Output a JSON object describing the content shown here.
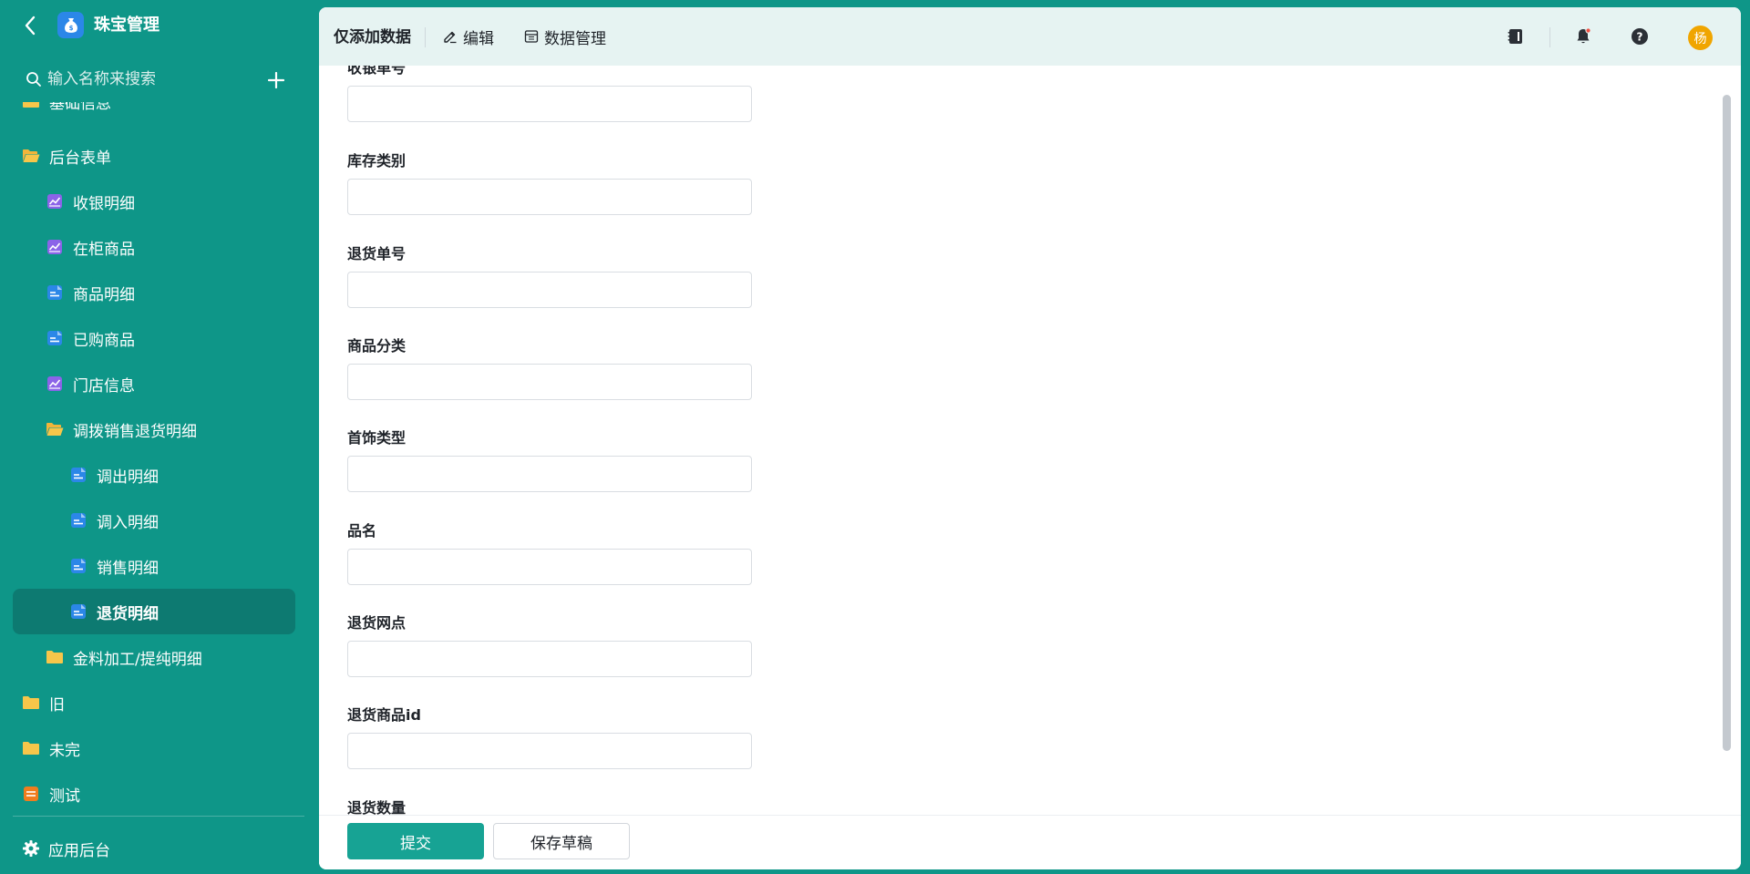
{
  "app": {
    "name": "珠宝管理",
    "search_placeholder": "输入名称来搜索"
  },
  "sidebar": {
    "items": [
      {
        "label": "基础信息",
        "icon": "folder-icon"
      },
      {
        "label": "后台表单",
        "icon": "folder-open-icon"
      },
      {
        "label": "收银明细",
        "icon": "report-chart-icon"
      },
      {
        "label": "在柜商品",
        "icon": "report-chart-icon"
      },
      {
        "label": "商品明细",
        "icon": "form-doc-icon"
      },
      {
        "label": "已购商品",
        "icon": "form-doc-icon"
      },
      {
        "label": "门店信息",
        "icon": "report-chart-icon"
      },
      {
        "label": "调拨销售退货明细",
        "icon": "folder-open-icon"
      },
      {
        "label": "调出明细",
        "icon": "form-doc-icon"
      },
      {
        "label": "调入明细",
        "icon": "form-doc-icon"
      },
      {
        "label": "销售明细",
        "icon": "form-doc-icon"
      },
      {
        "label": "退货明细",
        "icon": "form-doc-icon",
        "active": true
      },
      {
        "label": "金料加工/提纯明细",
        "icon": "folder-icon"
      },
      {
        "label": "旧",
        "icon": "folder-icon"
      },
      {
        "label": "未完",
        "icon": "folder-icon"
      },
      {
        "label": "测试",
        "icon": "orange-form-icon"
      }
    ],
    "footer_label": "应用后台"
  },
  "topbar": {
    "title": "仅添加数据",
    "edit_label": "编辑",
    "data_manage_label": "数据管理",
    "avatar_text": "杨"
  },
  "form": {
    "fields": [
      {
        "label": "收银单号",
        "value": ""
      },
      {
        "label": "库存类别",
        "value": ""
      },
      {
        "label": "退货单号",
        "value": ""
      },
      {
        "label": "商品分类",
        "value": ""
      },
      {
        "label": "首饰类型",
        "value": ""
      },
      {
        "label": "品名",
        "value": ""
      },
      {
        "label": "退货网点",
        "value": ""
      },
      {
        "label": "退货商品id",
        "value": ""
      },
      {
        "label": "退货数量",
        "value": ""
      }
    ]
  },
  "actions": {
    "submit_label": "提交",
    "draft_label": "保存草稿"
  },
  "colors": {
    "sidebar_bg": "#0e9688",
    "active_item_bg": "#0d7a71",
    "primary": "#17a394",
    "topbar_bg": "#e6f3f2",
    "avatar_bg": "#f0a500",
    "folder": "#f7c64a",
    "report_icon": "#8b63e8",
    "form_icon": "#2b87e8",
    "orange_form_icon": "#f07d1e"
  }
}
